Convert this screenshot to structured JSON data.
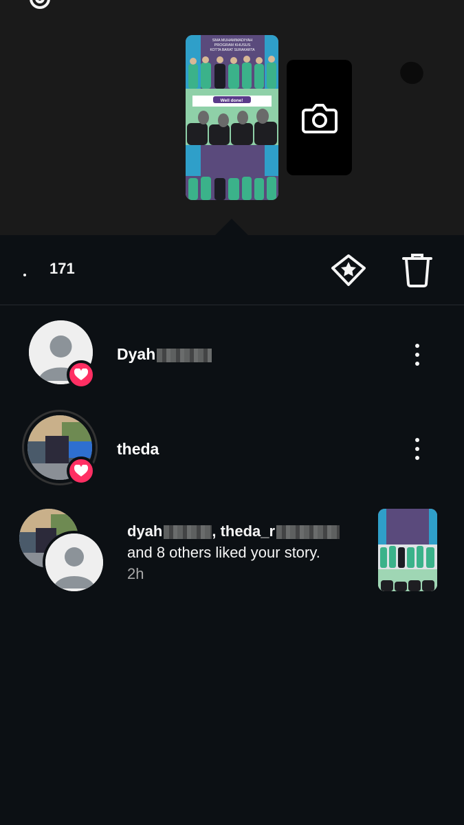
{
  "story": {
    "viewer_count_overlay": "171",
    "preview_texts": [
      "SMA MUHAMMADIYAH",
      "PROGRAM KHUSUS",
      "KOTTA BARAT SURAKARTA",
      "Well done!"
    ]
  },
  "viewer_bar": {
    "viewer_count": "171"
  },
  "viewers": [
    {
      "username": "Dyah",
      "liked": true
    },
    {
      "username": "theda",
      "liked": true
    }
  ],
  "notification": {
    "user1": "dyah",
    "separator": ", ",
    "user2": "theda_r",
    "message": "and 8 others liked your story.",
    "time": "2h"
  },
  "colors": {
    "background": "#0c1014",
    "top_background": "#1a1a1a",
    "heart": "#ff2f63",
    "muted": "#a8a8a8"
  },
  "icons": [
    "gear-icon",
    "close-icon",
    "camera-icon",
    "user-icon",
    "highlight-icon",
    "trash-icon",
    "heart-icon",
    "more-icon"
  ]
}
